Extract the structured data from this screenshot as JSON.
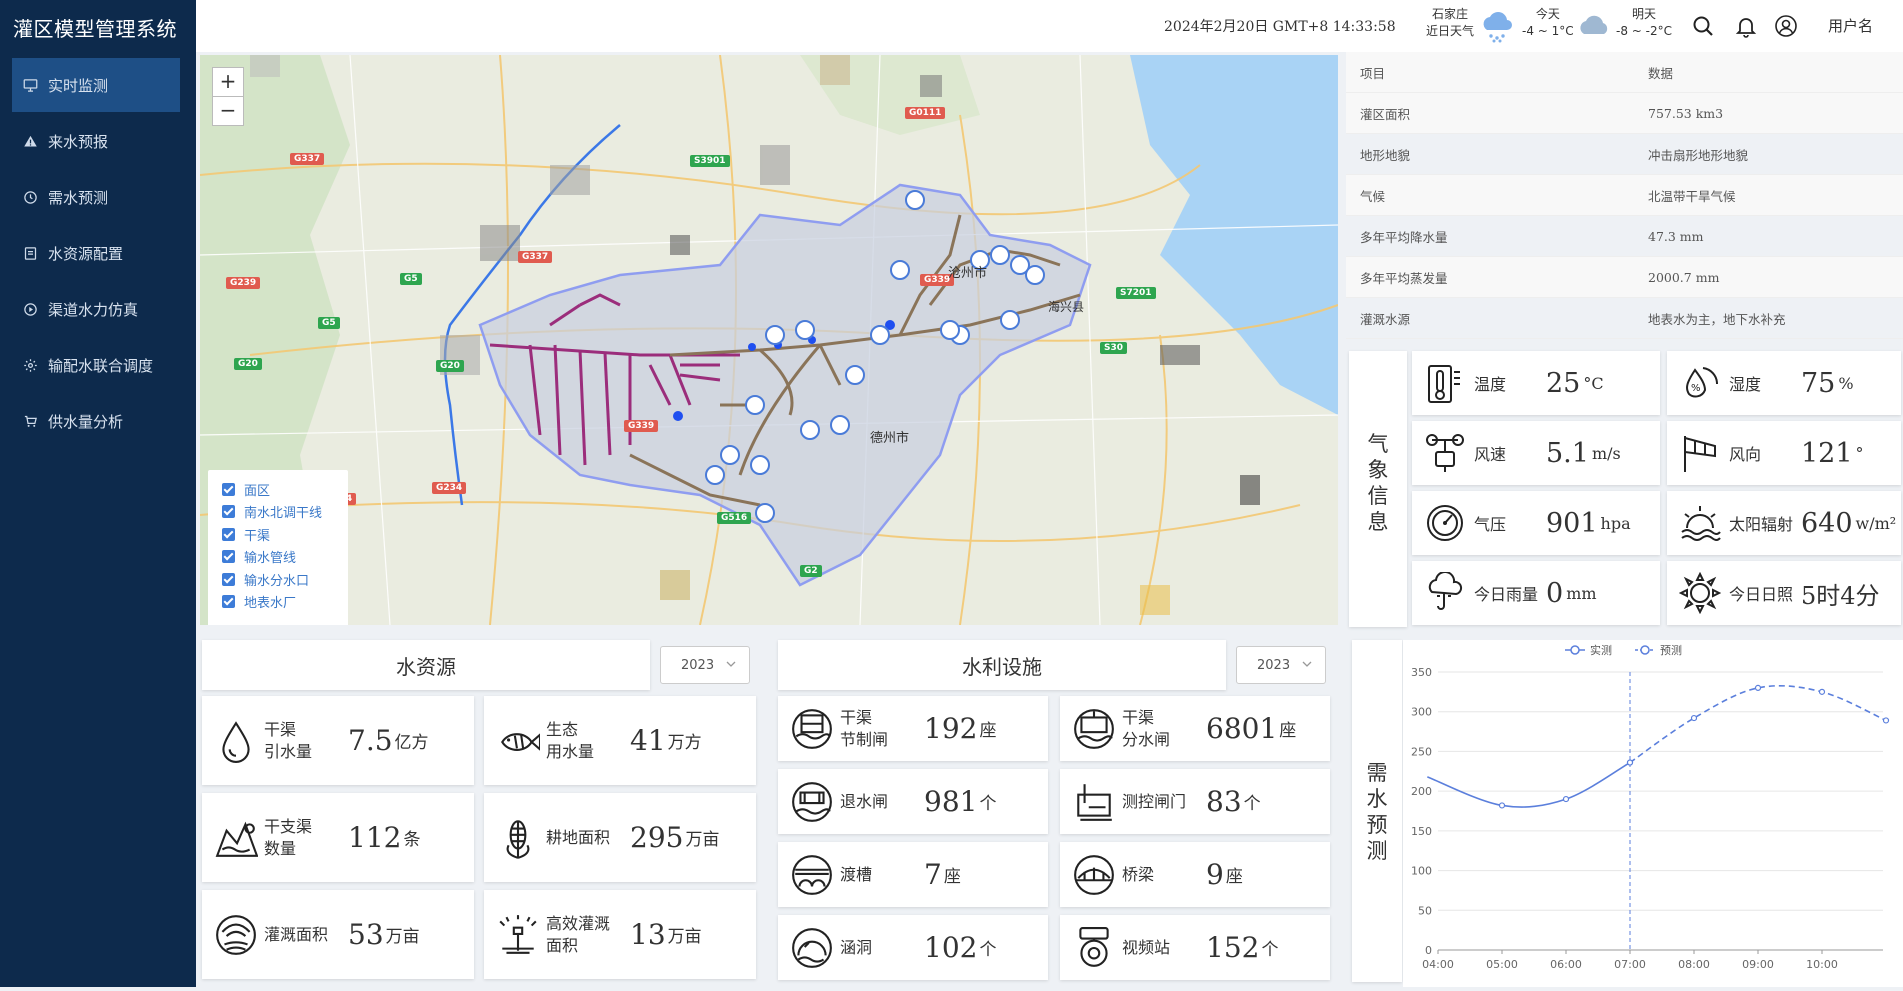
{
  "app": {
    "title": "灌区模型管理系统"
  },
  "sidebar": {
    "items": [
      {
        "label": "实时监测",
        "icon": "monitor-icon",
        "active": true
      },
      {
        "label": "来水预报",
        "icon": "warning-icon"
      },
      {
        "label": "需水预测",
        "icon": "clock-icon"
      },
      {
        "label": "水资源配置",
        "icon": "document-icon"
      },
      {
        "label": "渠道水力仿真",
        "icon": "play-circle-icon"
      },
      {
        "label": "输配水联合调度",
        "icon": "settings-icon"
      },
      {
        "label": "供水量分析",
        "icon": "cart-icon"
      }
    ]
  },
  "header": {
    "datetime": "2024年2月20日 GMT+8 14:33:58",
    "weather_city": "石家庄",
    "weather_recent": "近日天气",
    "today_label": "今天",
    "today_temp": "-4 ~ 1°C",
    "tomorrow_label": "明天",
    "tomorrow_temp": "-8 ~ -2°C",
    "user_name": "用户名",
    "icons": [
      "snow-cloud-icon",
      "cloud-icon",
      "search-icon",
      "bell-icon",
      "user-icon"
    ]
  },
  "map": {
    "zoom_in": "+",
    "zoom_out": "−",
    "legend": [
      "面区",
      "南水北调干线",
      "干渠",
      "输水管线",
      "输水分水口",
      "地表水厂"
    ],
    "road_labels": [
      "G337",
      "G0111",
      "S3901",
      "G337",
      "G239",
      "G5",
      "G5",
      "G20",
      "G20",
      "G339",
      "G339",
      "S7201",
      "S30",
      "G234",
      "G104",
      "G516",
      "G2"
    ],
    "place_labels": [
      "沧州市",
      "海兴县",
      "德州市"
    ]
  },
  "info_table": {
    "headers": [
      "项目",
      "数据"
    ],
    "rows": [
      [
        "灌区面积",
        "757.53 km3"
      ],
      [
        "地形地貌",
        "冲击扇形地形地貌"
      ],
      [
        "气候",
        "北温带干旱气候"
      ],
      [
        "多年平均降水量",
        "47.3 mm"
      ],
      [
        "多年平均蒸发量",
        "2000.7 mm"
      ],
      [
        "灌溉水源",
        "地表水为主，地下水补充"
      ]
    ]
  },
  "weather_panel": {
    "title": "气象信息",
    "items": [
      {
        "label": "温度",
        "value": "25",
        "unit": "°C",
        "icon": "thermometer-icon"
      },
      {
        "label": "湿度",
        "value": "75",
        "unit": "%",
        "icon": "humidity-icon"
      },
      {
        "label": "风速",
        "value": "5.1",
        "unit": "m/s",
        "icon": "anemometer-icon"
      },
      {
        "label": "风向",
        "value": "121",
        "unit": "°",
        "icon": "windsock-icon"
      },
      {
        "label": "气压",
        "value": "901",
        "unit": "hpa",
        "icon": "gauge-icon"
      },
      {
        "label": "太阳辐射",
        "value": "640",
        "unit": "w/m²",
        "icon": "solar-radiation-icon"
      },
      {
        "label": "今日雨量",
        "value": "0",
        "unit": "mm",
        "icon": "rain-icon"
      },
      {
        "label": "今日日照",
        "value": "5时4分",
        "unit": "",
        "icon": "sun-icon"
      }
    ]
  },
  "water_resources": {
    "title": "水资源",
    "year": "2023",
    "items": [
      {
        "label": "干渠\n引水量",
        "value": "7.5",
        "unit": "亿方",
        "icon": "water-drop-icon"
      },
      {
        "label": "生态\n用水量",
        "value": "41",
        "unit": "万方",
        "icon": "fish-icon"
      },
      {
        "label": "干支渠\n数量",
        "value": "112",
        "unit": "条",
        "icon": "canal-icon"
      },
      {
        "label": "耕地面积",
        "value": "295",
        "unit": "万亩",
        "icon": "corn-icon"
      },
      {
        "label": "灌溉面积",
        "value": "53",
        "unit": "万亩",
        "icon": "irrigation-icon"
      },
      {
        "label": "高效灌溉\n面积",
        "value": "13",
        "unit": "万亩",
        "icon": "sprinkler-icon"
      }
    ]
  },
  "facilities": {
    "title": "水利设施",
    "year": "2023",
    "items": [
      {
        "label": "干渠\n节制闸",
        "value": "192",
        "unit": "座",
        "icon": "sluice-gate-icon"
      },
      {
        "label": "干渠\n分水闸",
        "value": "6801",
        "unit": "座",
        "icon": "diversion-gate-icon"
      },
      {
        "label": "退水闸",
        "value": "981",
        "unit": "个",
        "icon": "drain-gate-icon"
      },
      {
        "label": "测控闸门",
        "value": "83",
        "unit": "个",
        "icon": "control-gate-icon"
      },
      {
        "label": "渡槽",
        "value": "7",
        "unit": "座",
        "icon": "aqueduct-icon"
      },
      {
        "label": "桥梁",
        "value": "9",
        "unit": "座",
        "icon": "bridge-icon"
      },
      {
        "label": "涵洞",
        "value": "102",
        "unit": "个",
        "icon": "culvert-icon"
      },
      {
        "label": "视频站",
        "value": "152",
        "unit": "个",
        "icon": "camera-icon"
      }
    ]
  },
  "demand_panel": {
    "title": "需水预测"
  },
  "chart_data": {
    "type": "line",
    "x": [
      "04:00",
      "05:00",
      "06:00",
      "07:00",
      "08:00",
      "09:00",
      "10:00"
    ],
    "ylim": [
      0,
      350
    ],
    "yticks": [
      0,
      50,
      100,
      150,
      200,
      250,
      300,
      350
    ],
    "legend": [
      "实测",
      "预测"
    ],
    "series": [
      {
        "name": "实测",
        "style": "solid",
        "points": [
          [
            "03:50",
            218
          ],
          [
            "05:00",
            182
          ],
          [
            "06:00",
            190
          ],
          [
            "07:00",
            236
          ]
        ]
      },
      {
        "name": "预测",
        "style": "dashed",
        "points": [
          [
            "07:00",
            236
          ],
          [
            "08:00",
            292
          ],
          [
            "09:00",
            330
          ],
          [
            "10:00",
            325
          ],
          [
            "11:00",
            289
          ]
        ]
      }
    ],
    "marker_line_x": "07:00",
    "color": "#5b7fdc"
  }
}
